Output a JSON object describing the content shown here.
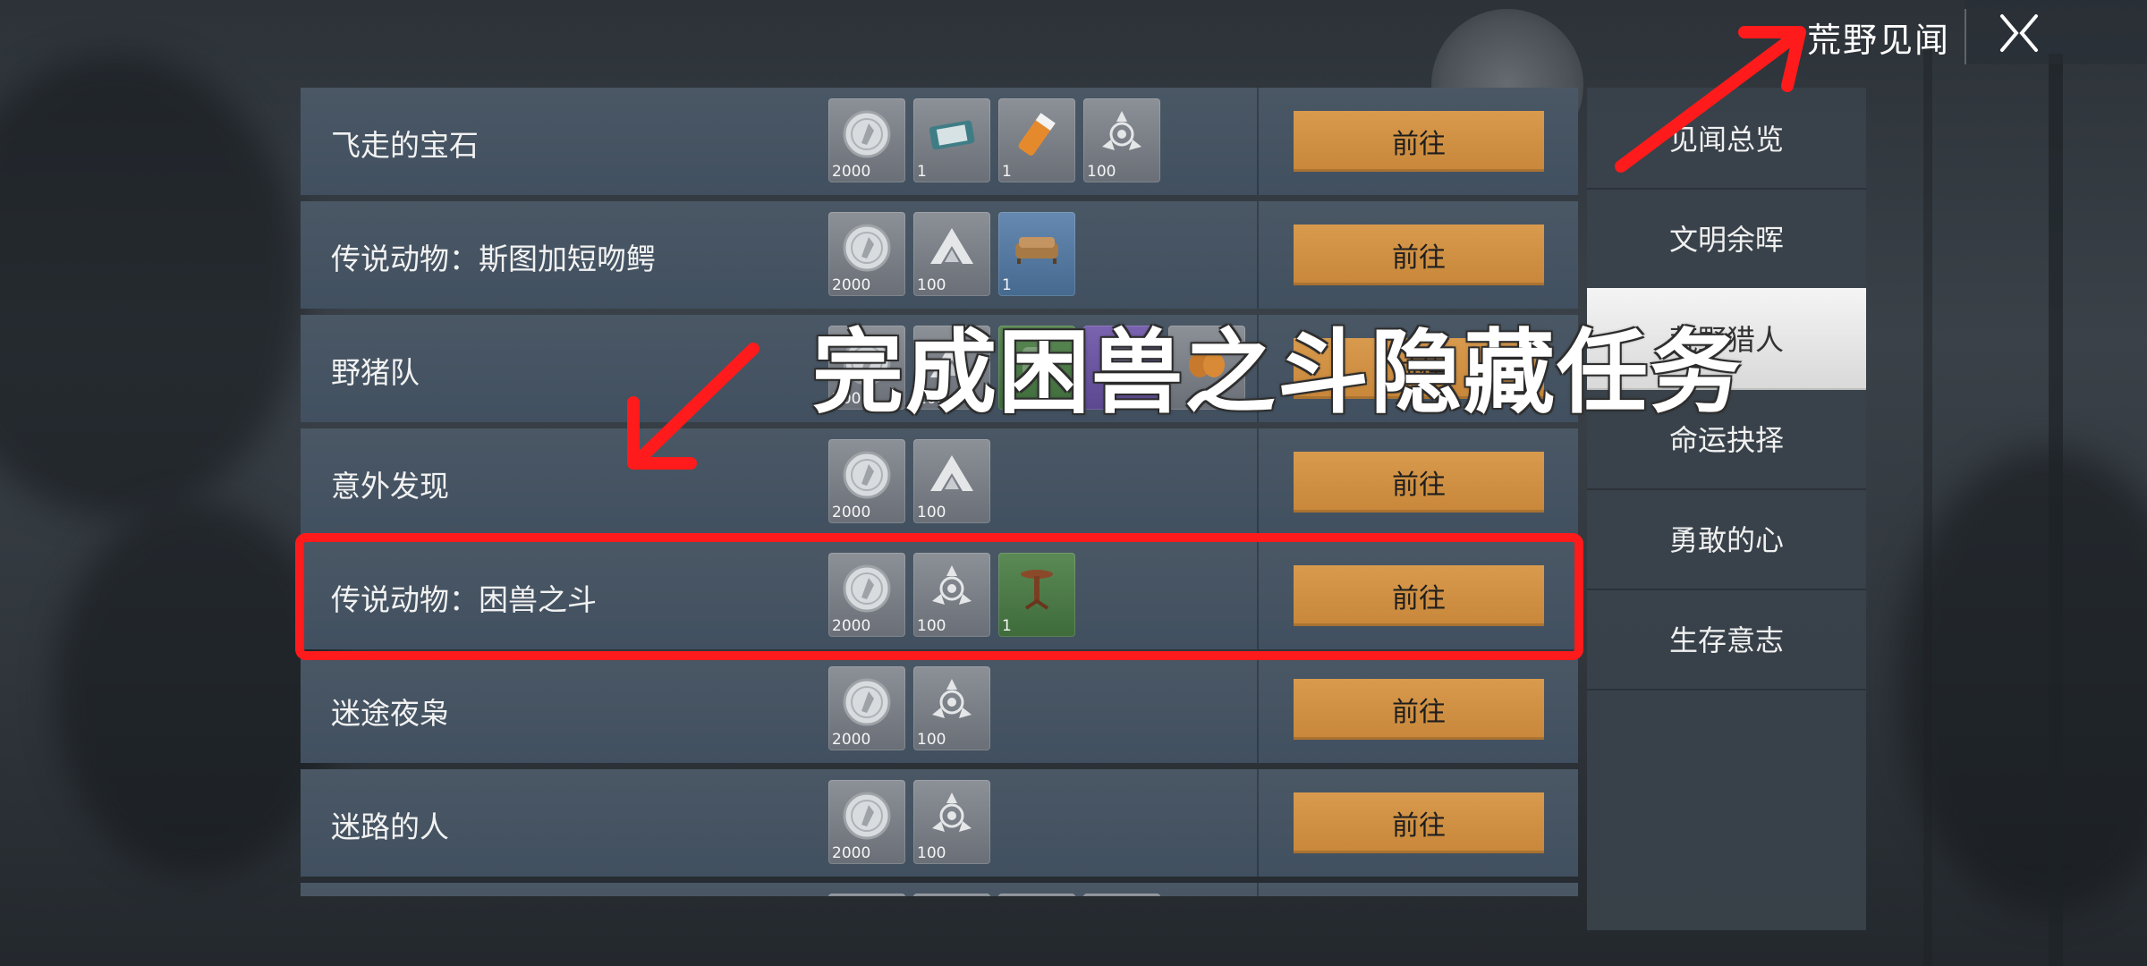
{
  "header": {
    "title": "荒野见闻"
  },
  "tasks": [
    {
      "name": "飞走的宝石",
      "button": "前往",
      "rewards": [
        {
          "icon": "silver-coin-icon",
          "count": "2000",
          "tone": "gray"
        },
        {
          "icon": "bandage-icon",
          "count": "1",
          "tone": "gray"
        },
        {
          "icon": "pill-bottle-icon",
          "count": "1",
          "tone": "gray"
        },
        {
          "icon": "emblem-icon",
          "count": "100",
          "tone": "gray"
        }
      ]
    },
    {
      "name": "传说动物：斯图加短吻鳄",
      "button": "前往",
      "rewards": [
        {
          "icon": "silver-coin-icon",
          "count": "2000",
          "tone": "gray"
        },
        {
          "icon": "mountain-badge-icon",
          "count": "100",
          "tone": "gray"
        },
        {
          "icon": "sofa-icon",
          "count": "1",
          "tone": "blue"
        }
      ]
    },
    {
      "name": "野猪队",
      "button": "前往",
      "rewards": [
        {
          "icon": "silver-coin-icon",
          "count": "2000",
          "tone": "gray"
        },
        {
          "icon": "mountain-badge-icon",
          "count": "100",
          "tone": "gray"
        },
        {
          "icon": "item-icon",
          "count": "1",
          "tone": "green"
        },
        {
          "icon": "item-icon",
          "count": "",
          "tone": "purple"
        },
        {
          "icon": "pumpkin-icon",
          "count": "",
          "tone": "gray"
        }
      ]
    },
    {
      "name": "意外发现",
      "button": "前往",
      "rewards": [
        {
          "icon": "silver-coin-icon",
          "count": "2000",
          "tone": "gray"
        },
        {
          "icon": "mountain-badge-icon",
          "count": "100",
          "tone": "gray"
        }
      ]
    },
    {
      "name": "传说动物：困兽之斗",
      "button": "前往",
      "rewards": [
        {
          "icon": "silver-coin-icon",
          "count": "2000",
          "tone": "gray"
        },
        {
          "icon": "emblem-icon",
          "count": "100",
          "tone": "gray"
        },
        {
          "icon": "side-table-icon",
          "count": "1",
          "tone": "green"
        }
      ]
    },
    {
      "name": "迷途夜枭",
      "button": "前往",
      "rewards": [
        {
          "icon": "silver-coin-icon",
          "count": "2000",
          "tone": "gray"
        },
        {
          "icon": "emblem-icon",
          "count": "100",
          "tone": "gray"
        }
      ]
    },
    {
      "name": "迷路的人",
      "button": "前往",
      "rewards": [
        {
          "icon": "silver-coin-icon",
          "count": "2000",
          "tone": "gray"
        },
        {
          "icon": "emblem-icon",
          "count": "100",
          "tone": "gray"
        }
      ]
    },
    {
      "name": "",
      "button": "",
      "rewards": [
        {
          "icon": "silver-coin-icon",
          "count": "",
          "tone": "gray"
        },
        {
          "icon": "emblem-icon",
          "count": "",
          "tone": "gray"
        },
        {
          "icon": "item-icon",
          "count": "",
          "tone": "gray"
        },
        {
          "icon": "item-icon",
          "count": "",
          "tone": "gray"
        }
      ]
    }
  ],
  "sidebar": {
    "items": [
      {
        "label": "见闻总览",
        "active": false
      },
      {
        "label": "文明余晖",
        "active": false
      },
      {
        "label": "荒野猎人",
        "active": true
      },
      {
        "label": "命运抉择",
        "active": false
      },
      {
        "label": "勇敢的心",
        "active": false
      },
      {
        "label": "生存意志",
        "active": false
      }
    ]
  },
  "annotation": {
    "caption": "完成困兽之斗隐藏任务",
    "color": "#ff1b1b",
    "highlighted_task_index": 4
  },
  "colors": {
    "button": "#d08f42",
    "row": "#455464",
    "sidebar_active": "#eaeaea"
  }
}
